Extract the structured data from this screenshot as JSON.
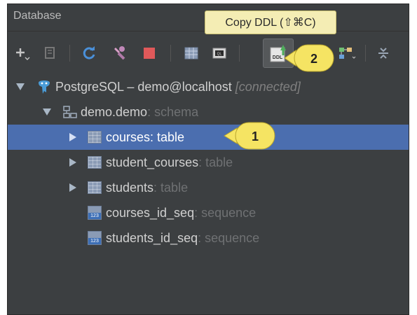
{
  "panel": {
    "title": "Database"
  },
  "tooltip": {
    "text": "Copy DDL (⇧⌘C)"
  },
  "toolbar": {
    "ddl_button_label": "DDL",
    "ql_button_label": "QL"
  },
  "callouts": [
    {
      "number": "1"
    },
    {
      "number": "2"
    }
  ],
  "tree": {
    "connection": {
      "name": "PostgreSQL – demo@localhost",
      "status": "[connected]"
    },
    "schema": {
      "name": "demo.demo",
      "kind": ": schema"
    },
    "items": [
      {
        "name": "courses",
        "kind": ": table",
        "type": "table",
        "selected": true
      },
      {
        "name": "student_courses",
        "kind": ": table",
        "type": "table",
        "selected": false
      },
      {
        "name": "students",
        "kind": ": table",
        "type": "table",
        "selected": false
      },
      {
        "name": "courses_id_seq",
        "kind": ": sequence",
        "type": "sequence",
        "selected": false
      },
      {
        "name": "students_id_seq",
        "kind": ": sequence",
        "type": "sequence",
        "selected": false
      }
    ],
    "seq_icon_label": "123"
  },
  "colors": {
    "panel_bg": "#3c3f41",
    "selection": "#4b6eaf",
    "tooltip_bg": "#f4edb4",
    "callout_bg": "#f5e463"
  }
}
